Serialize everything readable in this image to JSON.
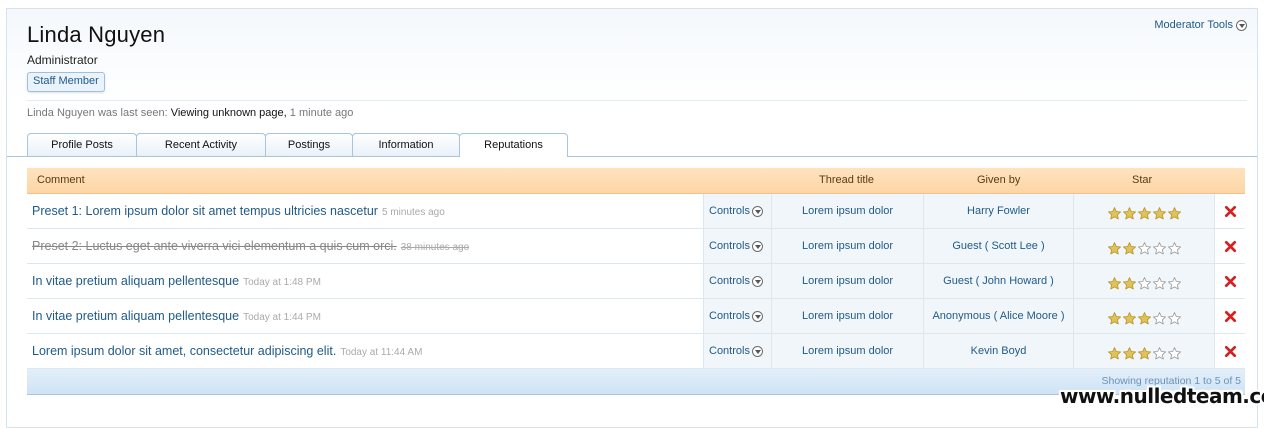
{
  "profile": {
    "name": "Linda Nguyen",
    "title": "Administrator",
    "badge": "Staff Member",
    "moderator_tools": "Moderator Tools",
    "last_seen_prefix": "Linda Nguyen was last seen:",
    "last_seen_activity": "Viewing unknown page",
    "last_seen_sep": ",",
    "last_seen_time": "1 minute ago"
  },
  "tabs": [
    {
      "label": "Profile Posts",
      "active": false
    },
    {
      "label": "Recent Activity",
      "active": false
    },
    {
      "label": "Postings",
      "active": false
    },
    {
      "label": "Information",
      "active": false
    },
    {
      "label": "Reputations",
      "active": true
    }
  ],
  "table": {
    "headers": {
      "comment": "Comment",
      "thread": "Thread title",
      "given_by": "Given by",
      "star": "Star"
    },
    "rows": [
      {
        "comment": "Preset 1: Lorem ipsum dolor sit amet tempus ultricies nascetur",
        "time": "5 minutes ago",
        "controls": "Controls",
        "thread": "Lorem ipsum dolor",
        "given_by": "Harry Fowler",
        "stars": 5,
        "struck": false
      },
      {
        "comment": "Preset 2: Luctus eget ante viverra vici elementum a quis cum orci.",
        "time": "38 minutes ago",
        "controls": "Controls",
        "thread": "Lorem ipsum dolor",
        "given_by": "Guest ( Scott Lee )",
        "stars": 2,
        "struck": true
      },
      {
        "comment": "In vitae pretium aliquam pellentesque",
        "time": "Today at 1:48 PM",
        "controls": "Controls",
        "thread": "Lorem ipsum dolor",
        "given_by": "Guest ( John Howard )",
        "stars": 2,
        "struck": false
      },
      {
        "comment": "In vitae pretium aliquam pellentesque",
        "time": "Today at 1:44 PM",
        "controls": "Controls",
        "thread": "Lorem ipsum dolor",
        "given_by": "Anonymous ( Alice Moore )",
        "stars": 3,
        "struck": false
      },
      {
        "comment": "Lorem ipsum dolor sit amet, consectetur adipiscing elit.",
        "time": "Today at 11:44 AM",
        "controls": "Controls",
        "thread": "Lorem ipsum dolor",
        "given_by": "Kevin Boyd",
        "stars": 3,
        "struck": false
      }
    ],
    "max_stars": 5,
    "footer_summary": "Showing reputation 1 to 5 of 5"
  },
  "watermark": "www.nulledteam.com",
  "colors": {
    "link": "#1f5a88",
    "header_bg": "#fcd5a6",
    "star_filled": "#e0c25a",
    "delete_red": "#d42020"
  }
}
